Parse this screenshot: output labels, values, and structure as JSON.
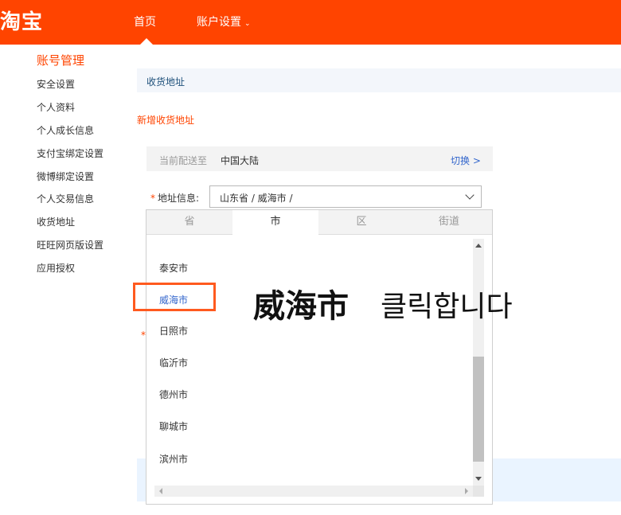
{
  "topbar": {
    "logo": "淘宝",
    "nav_home": "首页",
    "nav_account": "账户设置",
    "nav_caret": "⌄",
    "brand_color": "#ff4400"
  },
  "sidebar": {
    "title": "账号管理",
    "items": [
      {
        "label": "安全设置"
      },
      {
        "label": "个人资料"
      },
      {
        "label": "个人成长信息"
      },
      {
        "label": "支付宝绑定设置"
      },
      {
        "label": "微博绑定设置"
      },
      {
        "label": "个人交易信息"
      },
      {
        "label": "收货地址"
      },
      {
        "label": "旺旺网页版设置"
      },
      {
        "label": "应用授权"
      }
    ]
  },
  "main": {
    "section_title": "收货地址",
    "new_address_link": "新增收货地址",
    "delivery": {
      "label": "当前配送至",
      "value": "中国大陆",
      "switch_label": "切换 >"
    },
    "address_field": {
      "required_mark": "*",
      "label": "地址信息:",
      "value": "山东省 / 威海市 /"
    },
    "background_required_mark": "*"
  },
  "picker": {
    "tabs": [
      {
        "label": "省",
        "active": false
      },
      {
        "label": "市",
        "active": true
      },
      {
        "label": "区",
        "active": false
      },
      {
        "label": "街道",
        "active": false
      }
    ],
    "cities": [
      {
        "label": "泰安市",
        "selected": false
      },
      {
        "label": "威海市",
        "selected": true
      },
      {
        "label": "日照市",
        "selected": false
      },
      {
        "label": "临沂市",
        "selected": false
      },
      {
        "label": "德州市",
        "selected": false
      },
      {
        "label": "聊城市",
        "selected": false
      },
      {
        "label": "滨州市",
        "selected": false
      }
    ]
  },
  "annotation": {
    "target": "威海市",
    "action": "클릭합니다",
    "highlight_color": "#ff5a1f"
  }
}
